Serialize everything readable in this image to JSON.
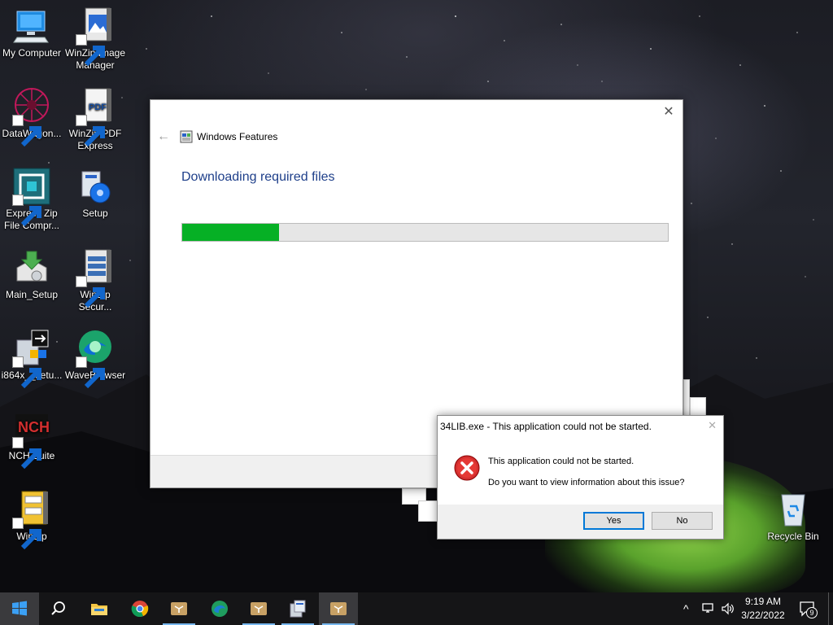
{
  "desktop": {
    "icons": [
      {
        "label": "My Computer",
        "icon": "computer-icon"
      },
      {
        "label": "WinZip Image Manager",
        "icon": "winzip-image-icon"
      },
      {
        "label": "DataWagon...",
        "icon": "datawagon-icon"
      },
      {
        "label": "WinZip PDF Express",
        "icon": "winzip-pdf-icon"
      },
      {
        "label": "Express Zip File Compr...",
        "icon": "express-zip-icon"
      },
      {
        "label": "Setup",
        "icon": "setup-icon"
      },
      {
        "label": "Main_Setup",
        "icon": "main-setup-icon"
      },
      {
        "label": "WinZip Secur...",
        "icon": "winzip-secure-icon"
      },
      {
        "label": "i864x__setu...",
        "icon": "installer-icon"
      },
      {
        "label": "WaveBrowser",
        "icon": "wavebrowser-icon"
      },
      {
        "label": "NCH Suite",
        "icon": "nch-icon"
      },
      {
        "label": "WinZip",
        "icon": "winzip-icon"
      },
      {
        "label": "Recycle Bin",
        "icon": "recycle-bin-icon"
      }
    ],
    "pdf_badge": "PDF",
    "nch_badge": "NCH"
  },
  "features_window": {
    "title": "Windows Features",
    "heading": "Downloading required files",
    "progress": 0.2,
    "accent": "#06b025",
    "back_arrow": "←",
    "close_glyph": "✕"
  },
  "error_dialog": {
    "title": "34LIB.exe - This application could not be started.",
    "message": "This application could not be started.",
    "question": "Do you want to view information about this issue?",
    "yes_label": "Yes",
    "no_label": "No",
    "close_glyph": "✕"
  },
  "taskbar": {
    "items": [
      "start-icon",
      "search-icon",
      "file-explorer-icon",
      "chrome-icon",
      "dropbox-icon",
      "edge-icon",
      "dropbox-icon",
      "installer-icon",
      "dropbox-icon"
    ],
    "time": "9:19 AM",
    "date": "3/22/2022",
    "notification_count": "9"
  }
}
